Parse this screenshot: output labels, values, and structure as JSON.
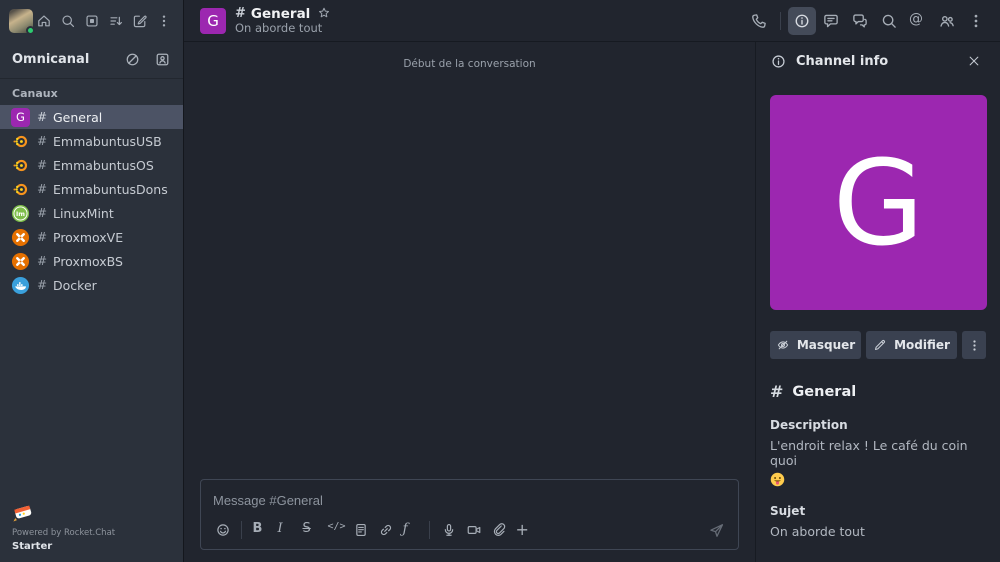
{
  "colors": {
    "channel_purple": "#9c27b0",
    "proxmox_orange": "#e57000",
    "mint_green": "#7ebe4a",
    "docker_blue": "#3aa0dc",
    "emmabuntus_orange": "#f7941d",
    "emmabuntus_yellow": "#ffd21c",
    "presence_online": "#2dcc70",
    "selected_row": "#4c5365"
  },
  "sidebar": {
    "topbar_icons": [
      {
        "name": "home-icon",
        "icon": "home"
      },
      {
        "name": "search-icon",
        "icon": "search"
      },
      {
        "name": "directory-icon",
        "icon": "directory"
      },
      {
        "name": "sort-icon",
        "icon": "sort"
      },
      {
        "name": "new-message-icon",
        "icon": "compose"
      },
      {
        "name": "kebab-menu-icon",
        "icon": "kebab"
      }
    ],
    "omnichannel": {
      "label": "Omnicanal",
      "icons": [
        {
          "name": "omnichannel-toggle-icon",
          "icon": "slash-circle"
        },
        {
          "name": "contact-center-icon",
          "icon": "contact"
        }
      ]
    },
    "section_label": "Canaux",
    "channels": [
      {
        "name": "General",
        "avatar": "letter",
        "letter": "G",
        "selected": true
      },
      {
        "name": "EmmabuntusUSB",
        "avatar": "emmabuntus"
      },
      {
        "name": "EmmabuntusOS",
        "avatar": "emmabuntus"
      },
      {
        "name": "EmmabuntusDons",
        "avatar": "emmabuntus"
      },
      {
        "name": "LinuxMint",
        "avatar": "mint"
      },
      {
        "name": "ProxmoxVE",
        "avatar": "proxmox"
      },
      {
        "name": "ProxmoxBS",
        "avatar": "proxmox"
      },
      {
        "name": "Docker",
        "avatar": "docker"
      }
    ],
    "footer": {
      "powered_by": "Powered by Rocket.Chat",
      "plan": "Starter"
    }
  },
  "chat": {
    "header": {
      "channel_initial": "G",
      "hash": "#",
      "channel_name": "General",
      "subtitle": "On aborde tout"
    },
    "header_actions": [
      {
        "name": "call-icon",
        "icon": "phone"
      },
      {
        "divider": true
      },
      {
        "name": "channel-info-icon",
        "icon": "info",
        "active": true
      },
      {
        "name": "threads-icon",
        "icon": "threads"
      },
      {
        "name": "discussions-icon",
        "icon": "discussions"
      },
      {
        "name": "search-messages-icon",
        "icon": "search"
      },
      {
        "name": "mentions-icon",
        "icon": "at"
      },
      {
        "name": "members-icon",
        "icon": "members"
      },
      {
        "name": "kebab-menu-icon",
        "icon": "kebab"
      }
    ],
    "conversation_start": "Début de la conversation",
    "composer": {
      "placeholder": "Message #General",
      "toolbar": [
        {
          "name": "emoji-icon",
          "icon": "emoji"
        },
        {
          "divider": true
        },
        {
          "name": "bold-icon",
          "icon": "bold"
        },
        {
          "name": "italic-icon",
          "icon": "italic"
        },
        {
          "name": "strikethrough-icon",
          "icon": "strike"
        },
        {
          "name": "inline-code-icon",
          "icon": "code"
        },
        {
          "name": "multiline-icon",
          "icon": "multiline"
        },
        {
          "name": "link-icon",
          "icon": "link"
        },
        {
          "name": "katex-icon",
          "icon": "katex"
        },
        {
          "divider": true
        },
        {
          "name": "audio-message-icon",
          "icon": "mic"
        },
        {
          "name": "video-message-icon",
          "icon": "video"
        },
        {
          "name": "attach-file-icon",
          "icon": "clip"
        },
        {
          "name": "plus-icon",
          "icon": "plus"
        }
      ],
      "send_icon": "send-icon"
    }
  },
  "panel": {
    "title": "Channel info",
    "avatar_letter": "G",
    "hide_button": "Masquer",
    "edit_button": "Modifier",
    "hash": "#",
    "channel_name": "General",
    "description_label": "Description",
    "description_value": "L'endroit relax ! Le café du coin quoi",
    "description_emoji": "face-with-tongue-emoji",
    "subject_label": "Sujet",
    "subject_value": "On aborde tout"
  }
}
